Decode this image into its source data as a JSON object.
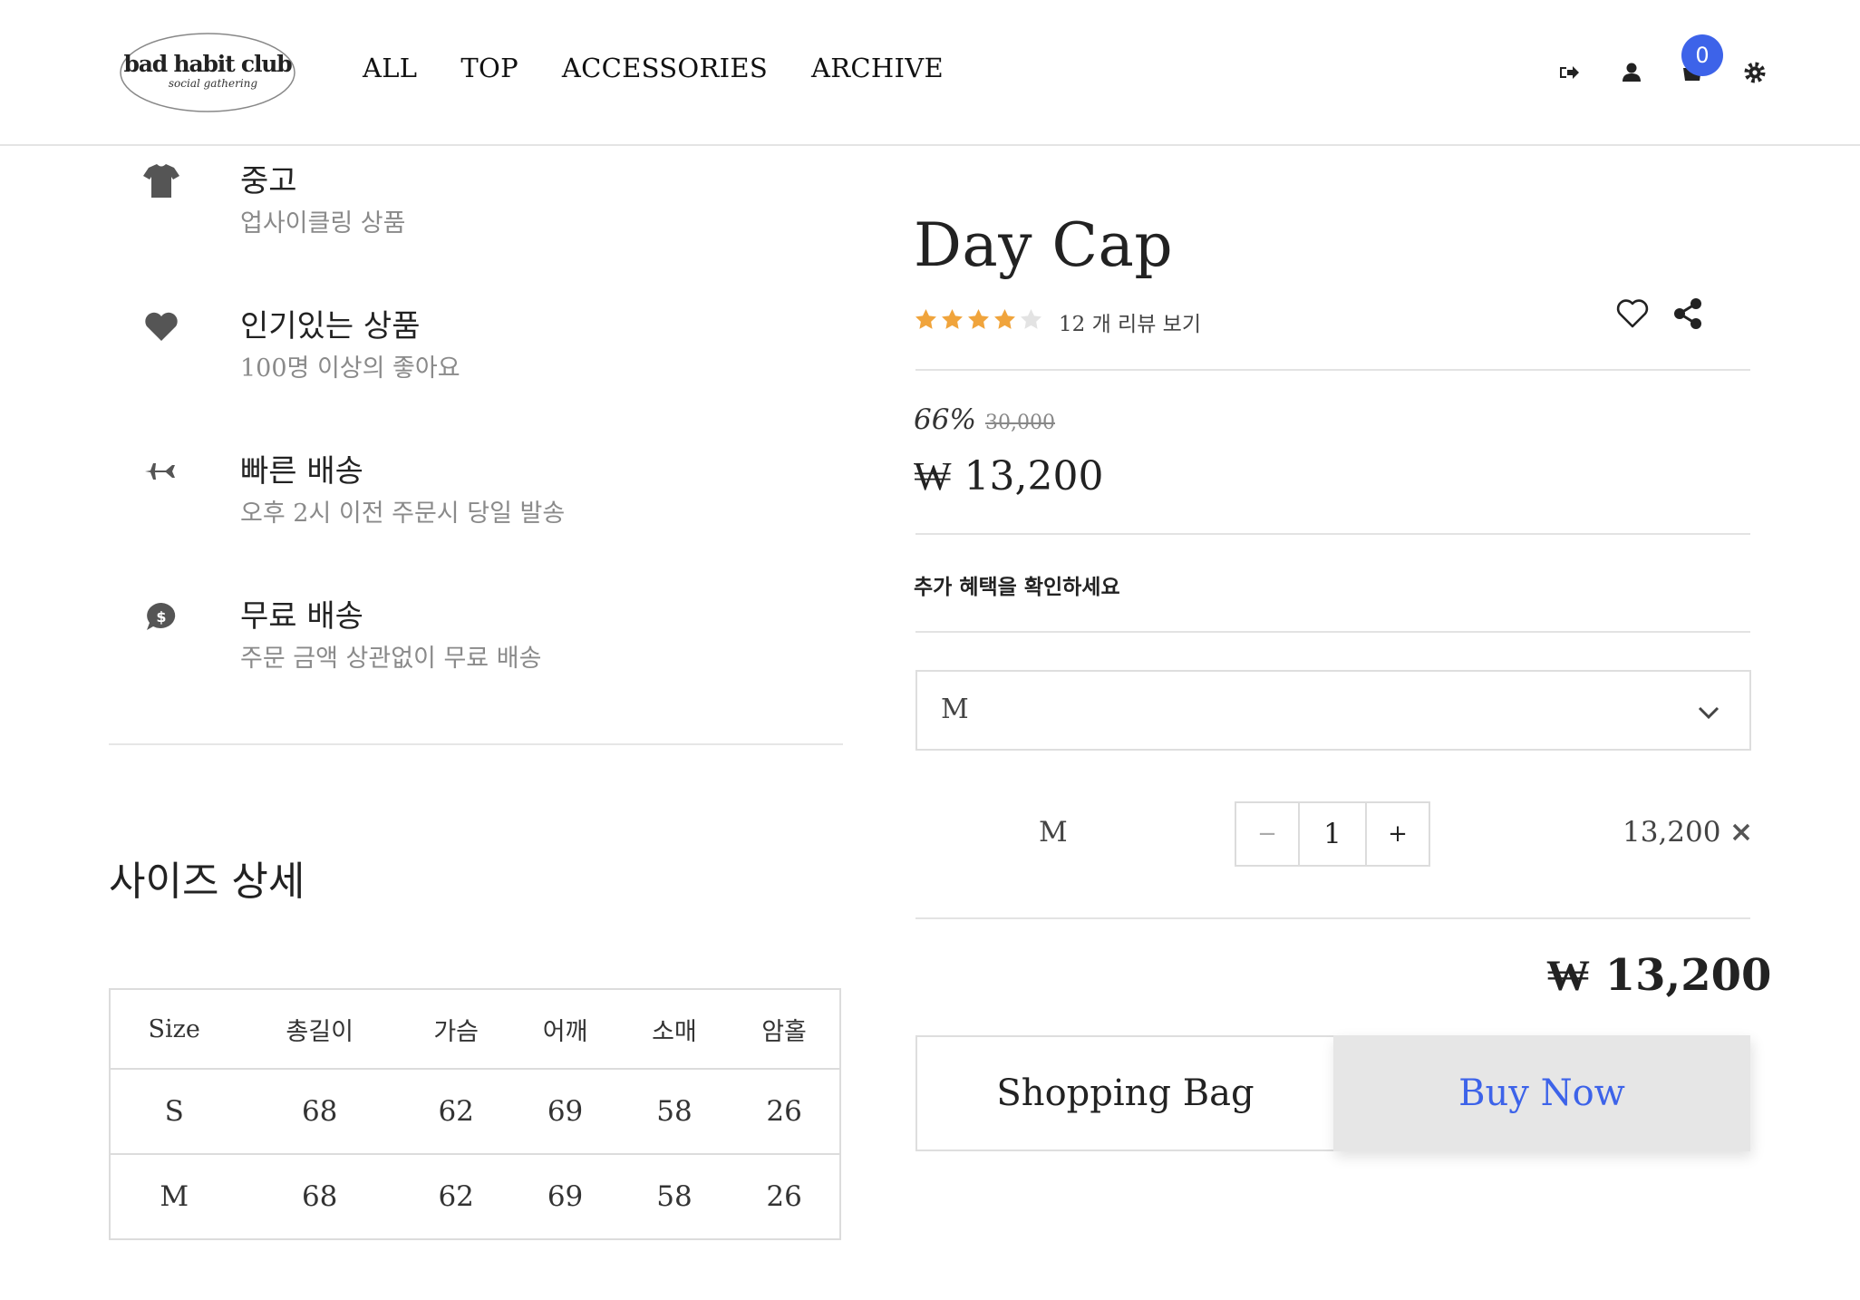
{
  "header": {
    "logo_text": "bad habit club",
    "logo_sub": "social gathering",
    "nav": [
      "ALL",
      "TOP",
      "ACCESSORIES",
      "ARCHIVE"
    ],
    "cart_count": "0",
    "icons": [
      "logout-icon",
      "user-icon",
      "cart-icon",
      "gear-icon"
    ]
  },
  "features": [
    {
      "icon": "tshirt-icon",
      "title": "중고",
      "desc": "업사이클링 상품"
    },
    {
      "icon": "heart-icon",
      "title": "인기있는 상품",
      "desc": "100명 이상의 좋아요"
    },
    {
      "icon": "plane-icon",
      "title": "빠른 배송",
      "desc": "오후 2시 이전 주문시 당일 발송"
    },
    {
      "icon": "dollar-chat-icon",
      "title": "무료 배송",
      "desc": "주문 금액 상관없이 무료 배송"
    }
  ],
  "size_section": {
    "title": "사이즈 상세",
    "headers": [
      "Size",
      "총길이",
      "가슴",
      "어깨",
      "소매",
      "암홀"
    ],
    "rows": [
      [
        "S",
        "68",
        "62",
        "69",
        "58",
        "26"
      ],
      [
        "M",
        "68",
        "62",
        "69",
        "58",
        "26"
      ]
    ]
  },
  "product": {
    "title": "Day Cap",
    "rating": 4,
    "rating_max": 5,
    "review_text": "12 개 리뷰 보기",
    "discount": "66%",
    "original_price": "30,000",
    "price": "₩ 13,200",
    "benefit_text": "추가 혜택을 확인하세요",
    "selected_option": "M",
    "line_item": {
      "name": "M",
      "qty": "1",
      "price": "13,200",
      "minus": "−",
      "plus": "+"
    },
    "total": "₩ 13,200",
    "bag_label": "Shopping Bag",
    "buy_label": "Buy Now"
  },
  "colors": {
    "accent": "#3d63e9",
    "star": "#f0a43c",
    "star_empty": "#e3e3e3"
  }
}
